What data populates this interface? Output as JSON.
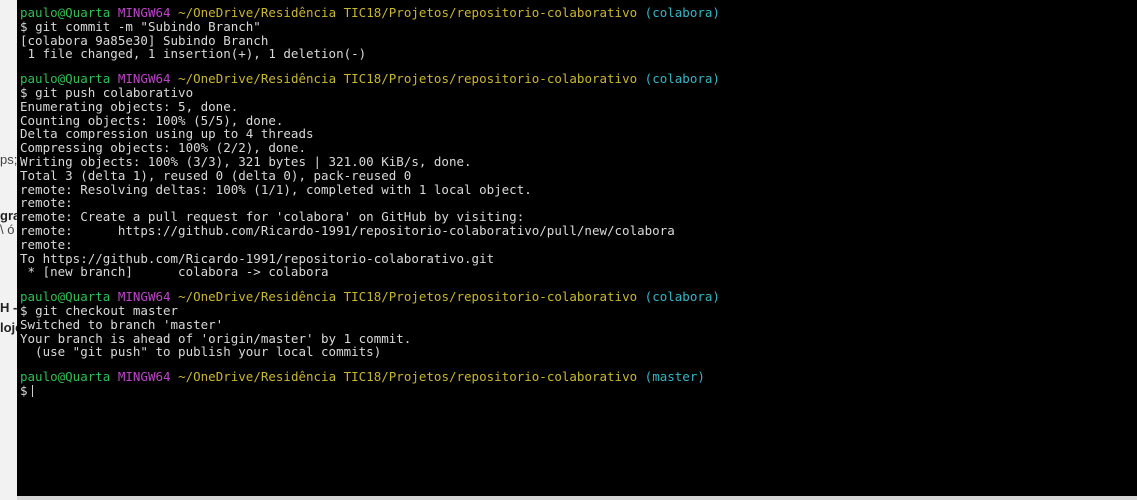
{
  "background_snippets": [
    "ps;",
    "gran",
    "\\ ó",
    "H -",
    "loje"
  ],
  "prompt": {
    "user_host": "paulo@Quarta",
    "system": "MINGW64",
    "path": "~/OneDrive/Residência TIC18/Projetos/repositorio-colaborativo",
    "branch_colabora": "(colabora)",
    "branch_master": "(master)",
    "symbol": "$"
  },
  "block1": {
    "command": "git commit -m \"Subindo Branch\"",
    "output": [
      "[colabora 9a85e30] Subindo Branch",
      " 1 file changed, 1 insertion(+), 1 deletion(-)"
    ]
  },
  "block2": {
    "command": "git push colaborativo",
    "output": [
      "Enumerating objects: 5, done.",
      "Counting objects: 100% (5/5), done.",
      "Delta compression using up to 4 threads",
      "Compressing objects: 100% (2/2), done.",
      "Writing objects: 100% (3/3), 321 bytes | 321.00 KiB/s, done.",
      "Total 3 (delta 1), reused 0 (delta 0), pack-reused 0",
      "remote: Resolving deltas: 100% (1/1), completed with 1 local object.",
      "remote:",
      "remote: Create a pull request for 'colabora' on GitHub by visiting:",
      "remote:      https://github.com/Ricardo-1991/repositorio-colaborativo/pull/new/colabora",
      "remote:",
      "To https://github.com/Ricardo-1991/repositorio-colaborativo.git",
      " * [new branch]      colabora -> colabora"
    ]
  },
  "block3": {
    "command": "git checkout master",
    "output": [
      "Switched to branch 'master'",
      "Your branch is ahead of 'origin/master' by 1 commit.",
      "  (use \"git push\" to publish your local commits)"
    ]
  }
}
